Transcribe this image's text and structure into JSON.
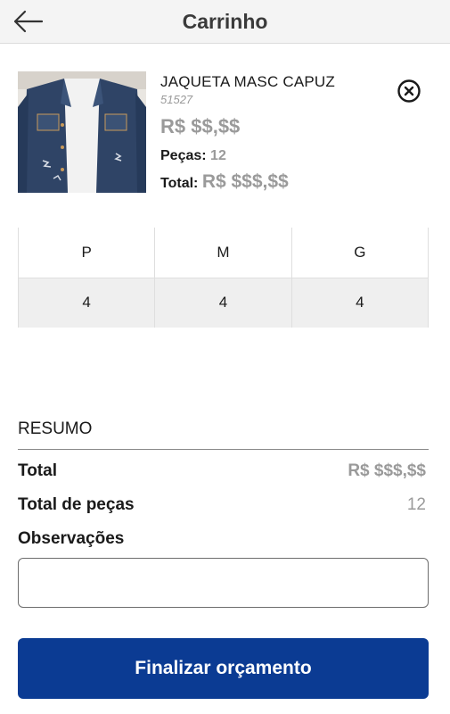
{
  "app_bar": {
    "title": "Carrinho",
    "back_icon": "arrow-left-icon"
  },
  "product": {
    "name": "JAQUETA MASC CAPUZ",
    "code": "51527",
    "price": "R$ $$,$$",
    "qty_label": "Peças:",
    "qty_value": "12",
    "total_label": "Total:",
    "total_value": "R$ $$$,$$",
    "remove_icon": "close-circle-icon",
    "image": "denim-jacket-photo"
  },
  "size_grid": {
    "sizes": [
      "P",
      "M",
      "G"
    ],
    "quantities": [
      "4",
      "4",
      "4"
    ]
  },
  "summary": {
    "title": "RESUMO",
    "total_label": "Total",
    "total_value": "R$ $$$,$$",
    "pieces_label": "Total de peças",
    "pieces_value": "12",
    "notes_label": "Observações",
    "notes_value": "",
    "notes_placeholder": ""
  },
  "cta": {
    "label": "Finalizar orçamento"
  },
  "colors": {
    "primary": "#0b3b93",
    "muted_text": "#9a9a9a",
    "app_bar_bg": "#f4f4f4",
    "table_row_bg": "#efefef"
  }
}
